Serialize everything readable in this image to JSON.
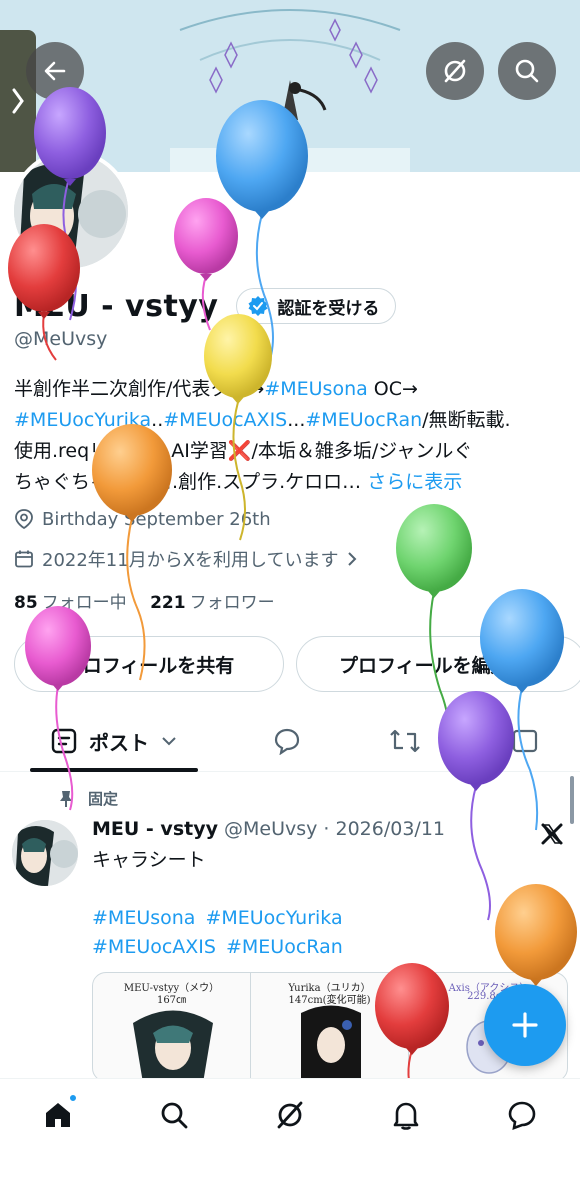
{
  "banner": {
    "colors": {
      "sky": "#c8e3ee",
      "accent": "#8a6cc8"
    }
  },
  "header": {
    "back_icon": "arrow-left-icon",
    "grok_icon": "grok-icon",
    "search_icon": "search-icon"
  },
  "profile": {
    "name": "MEU - vstyy",
    "handle": "@MeUvsy",
    "verify_label": "認証を受ける",
    "bio": {
      "line1_text": "半創作半二次創作/代表タグ→",
      "line1_tag": "#MEUsona",
      "line1_suffix": " OC→",
      "line2_tag1": "#MEUocYurika",
      "line2_sep": "..",
      "line2_tag2": "#MEUocAXIS",
      "line2_sep2": "...",
      "line2_tag3": "#MEUocRan",
      "line2_suffix": "/無断転載.",
      "line3": "使用.reqリプレス.AI学習❌/本垢＆雑多垢/ジャンルぐ",
      "line4": "ちゃぐちゃ ボカロ.創作.スプラ.ケロロ…",
      "show_more": "さらに表示"
    },
    "birthday": "Birthday September 26th",
    "joined": "2022年11月からXを利用しています",
    "following_count": "85",
    "following_label": "フォロー中",
    "followers_count": "221",
    "followers_label": "フォロワー",
    "share_button": "プロフィールを共有",
    "edit_button": "プロフィールを編集"
  },
  "tabs": {
    "posts_label": "ポスト"
  },
  "post": {
    "pinned_label": "固定",
    "author": "MEU - vstyy",
    "handle_date": "@MeUvsy · 2026/03/11",
    "text": "キャラシート",
    "tags": [
      "#MEUsona",
      "#MEUocYurika",
      "#MEUocAXIS",
      "#MEUocRan"
    ],
    "media": {
      "cell1": "MEU-vstyy（メウ）",
      "cell1_height": "167㎝",
      "cell2": "Yurika（ユリカ）",
      "cell2_height": "147cm(変化可能)",
      "cell3": "Axis（アクシス）",
      "cell3_height": "229.8cm"
    }
  },
  "nav": {
    "items": [
      "home-icon",
      "search-icon",
      "grok-icon",
      "bell-icon",
      "message-icon"
    ],
    "accent": "#1d9bf0"
  },
  "balloon_colors": [
    "#8e5fe0",
    "#e33d3d",
    "#e85bd0",
    "#4ea7f2",
    "#f2dc4d",
    "#f29a3a",
    "#6fd46f"
  ]
}
